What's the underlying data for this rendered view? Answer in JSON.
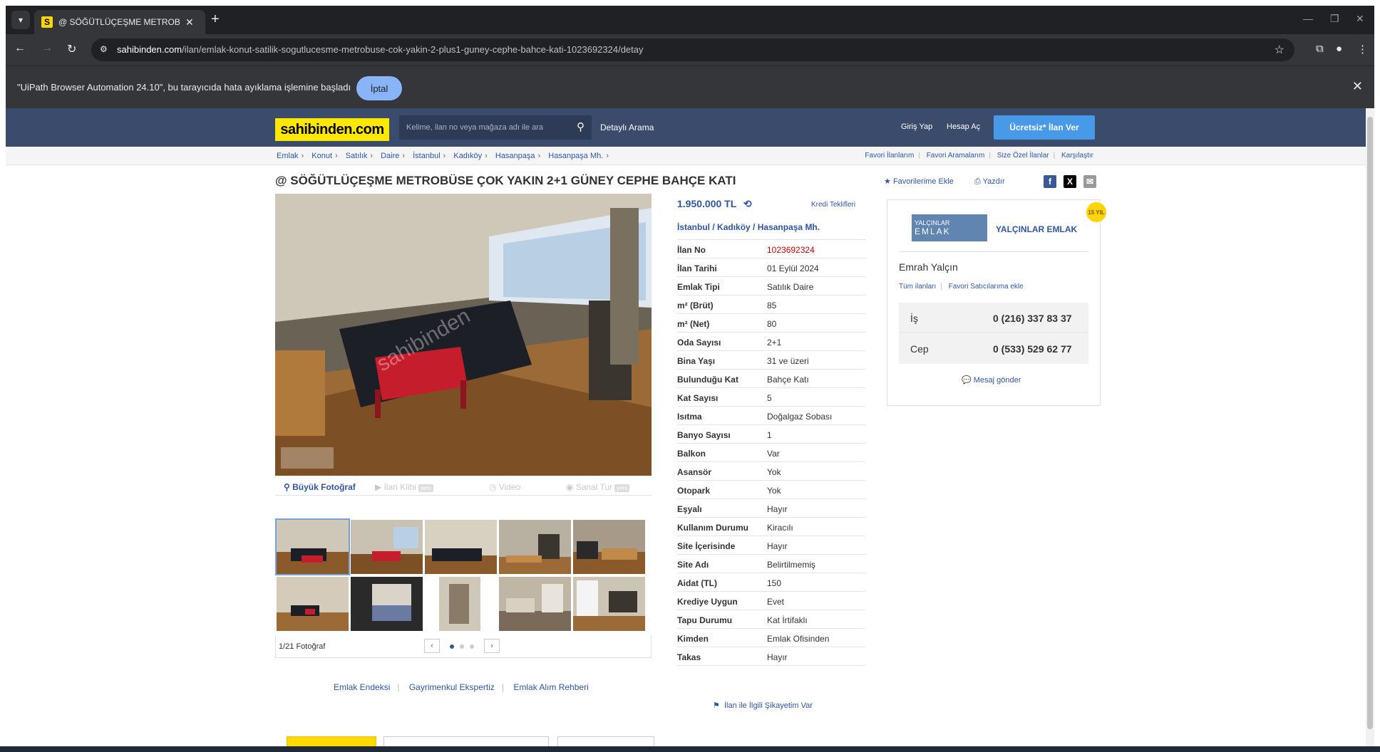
{
  "browser": {
    "tab_title": "@ SÖĞÜTLÜÇEŞME METROBÜS",
    "favicon_letter": "S",
    "url_host": "sahibinden.com",
    "url_path": "/ilan/emlak-konut-satilik-sogutlucesme-metrobuse-cok-yakin-2-plus1-guney-cephe-bahce-kati-1023692324/detay",
    "infobar_message": "\"UiPath Browser Automation 24.10\", bu tarayıcıda hata ayıklama işlemine başladı",
    "infobar_cancel": "İptal"
  },
  "header": {
    "logo": "sahibinden.com",
    "search_placeholder": "Kelime, ilan no veya mağaza adı ile ara",
    "detailed_search": "Detaylı Arama",
    "login": "Giriş Yap",
    "register": "Hesap Aç",
    "post_ad": "Ücretsiz* İlan Ver"
  },
  "breadcrumbs": [
    "Emlak",
    "Konut",
    "Satılık",
    "Daire",
    "İstanbul",
    "Kadıköy",
    "Hasanpaşa",
    "Hasanpaşa Mh."
  ],
  "top_links": [
    "Favori İlanlarım",
    "Favori Aramalarım",
    "Size Özel İlanlar",
    "Karşılaştır"
  ],
  "listing": {
    "title": "@ SÖĞÜTLÜÇEŞME METROBÜSE ÇOK YAKIN 2+1 GÜNEY CEPHE BAHÇE KATI",
    "add_favorite": "Favorilerime Ekle",
    "print": "Yazdır",
    "price": "1.950.000 TL",
    "loan_offers": "Kredi Teklifleri",
    "location": [
      "İstanbul",
      "Kadıköy",
      "Hasanpaşa Mh."
    ],
    "complaint": "İlan ile İlgili Şikayetim Var"
  },
  "gallery": {
    "tabs": [
      "Büyük Fotoğraf",
      "İlan Klibi",
      "Video",
      "Sanal Tur"
    ],
    "new_badge": "yeni",
    "counter": "1/21 Fotoğraf",
    "watermark": "sahibinden"
  },
  "specs": [
    {
      "k": "İlan No",
      "v": "1023692324"
    },
    {
      "k": "İlan Tarihi",
      "v": "01 Eylül 2024"
    },
    {
      "k": "Emlak Tipi",
      "v": "Satılık Daire"
    },
    {
      "k": "m² (Brüt)",
      "v": "85"
    },
    {
      "k": "m² (Net)",
      "v": "80"
    },
    {
      "k": "Oda Sayısı",
      "v": "2+1"
    },
    {
      "k": "Bina Yaşı",
      "v": "31 ve üzeri"
    },
    {
      "k": "Bulunduğu Kat",
      "v": "Bahçe Katı"
    },
    {
      "k": "Kat Sayısı",
      "v": "5"
    },
    {
      "k": "Isıtma",
      "v": "Doğalgaz Sobası"
    },
    {
      "k": "Banyo Sayısı",
      "v": "1"
    },
    {
      "k": "Balkon",
      "v": "Var"
    },
    {
      "k": "Asansör",
      "v": "Yok"
    },
    {
      "k": "Otopark",
      "v": "Yok"
    },
    {
      "k": "Eşyalı",
      "v": "Hayır"
    },
    {
      "k": "Kullanım Durumu",
      "v": "Kiracılı"
    },
    {
      "k": "Site İçerisinde",
      "v": "Hayır"
    },
    {
      "k": "Site Adı",
      "v": "Belirtilmemiş"
    },
    {
      "k": "Aidat (TL)",
      "v": "150"
    },
    {
      "k": "Krediye Uygun",
      "v": "Evet"
    },
    {
      "k": "Tapu Durumu",
      "v": "Kat İrtifaklı"
    },
    {
      "k": "Kimden",
      "v": "Emlak Ofisinden"
    },
    {
      "k": "Takas",
      "v": "Hayır"
    }
  ],
  "store": {
    "logo_top": "YALÇINLAR",
    "logo_bottom": "EMLAK",
    "name": "YALÇINLAR EMLAK",
    "years_badge": "15 YIL",
    "agent": "Emrah Yalçın",
    "all_listings": "Tüm ilanları",
    "add_fav_seller": "Favori Satıcılarıma ekle",
    "phones": [
      {
        "k": "İş",
        "v": "0 (216) 337 83 37"
      },
      {
        "k": "Cep",
        "v": "0 (533) 529 62 77"
      }
    ],
    "send_message": "Mesaj gönder"
  },
  "bottom_links": [
    "Emlak Endeksi",
    "Gayrimenkul Ekspertiz",
    "Emlak Alım Rehberi"
  ]
}
